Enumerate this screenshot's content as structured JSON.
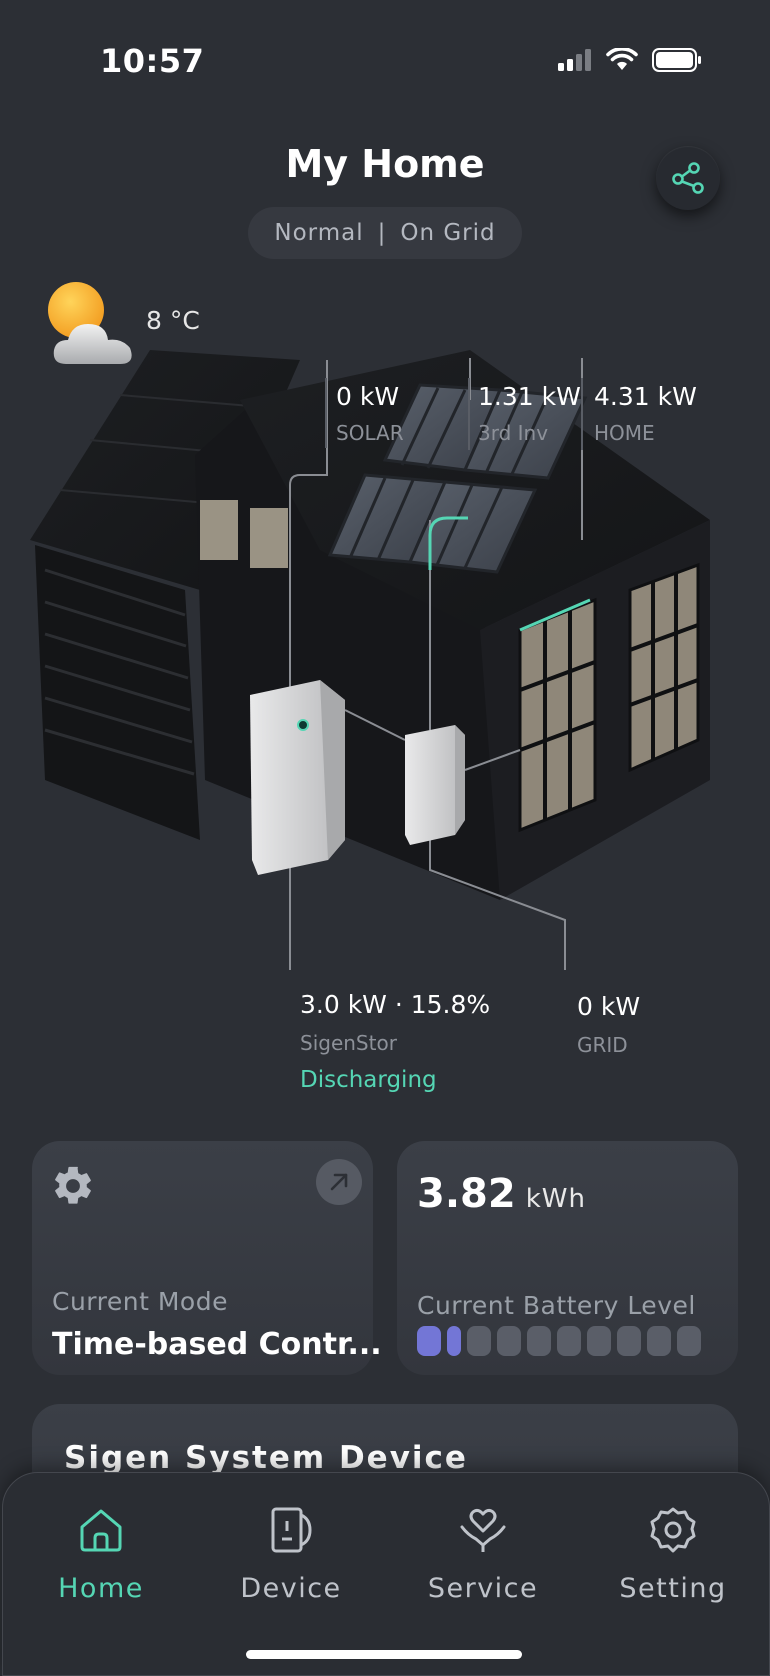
{
  "status_bar": {
    "time": "10:57"
  },
  "header": {
    "title": "My Home",
    "mode": "Normal",
    "separator": "|",
    "grid_status": "On Grid"
  },
  "weather": {
    "icon": "partly-cloudy-icon",
    "temperature": "8 °C"
  },
  "flows": {
    "solar": {
      "value": "0 kW",
      "label": "SOLAR"
    },
    "third_inv": {
      "value": "1.31 kW",
      "label": "3rd Inv"
    },
    "home": {
      "value": "4.31 kW",
      "label": "HOME"
    },
    "sigenstor": {
      "value": "3.0 kW · 15.8%",
      "label": "SigenStor",
      "state": "Discharging"
    },
    "grid": {
      "value": "0 kW",
      "label": "GRID"
    }
  },
  "mode_card": {
    "label": "Current Mode",
    "value": "Time-based Contr..."
  },
  "battery_card": {
    "value": "3.82",
    "unit": "kWh",
    "label": "Current Battery Level",
    "segments_total": 10,
    "segments_filled": 2
  },
  "devices_section": {
    "title": "Sigen System Device"
  },
  "nav": {
    "items": [
      {
        "label": "Home",
        "icon": "home-icon",
        "active": true
      },
      {
        "label": "Device",
        "icon": "device-icon",
        "active": false
      },
      {
        "label": "Service",
        "icon": "service-heart-icon",
        "active": false
      },
      {
        "label": "Setting",
        "icon": "gear-icon",
        "active": false
      }
    ]
  },
  "colors": {
    "accent": "#55d6b4",
    "battery_fill": "#7376d6",
    "background": "#2c2f35"
  }
}
